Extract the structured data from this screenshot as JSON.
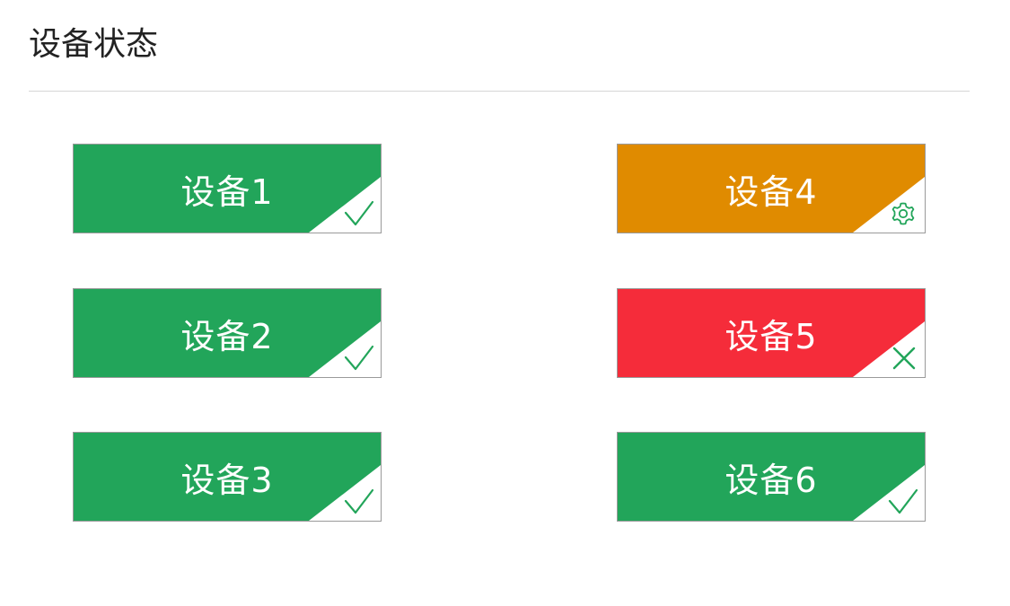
{
  "page": {
    "title": "设备状态"
  },
  "colors": {
    "normal": "#22a55a",
    "maintenance": "#e08b00",
    "error": "#f52c3a",
    "icon_green": "#22a55a"
  },
  "devices": [
    {
      "label": "设备1",
      "status": "normal",
      "icon": "check-icon"
    },
    {
      "label": "设备2",
      "status": "normal",
      "icon": "check-icon"
    },
    {
      "label": "设备3",
      "status": "normal",
      "icon": "check-icon"
    },
    {
      "label": "设备4",
      "status": "maintenance",
      "icon": "gear-icon"
    },
    {
      "label": "设备5",
      "status": "error",
      "icon": "close-icon"
    },
    {
      "label": "设备6",
      "status": "normal",
      "icon": "check-icon"
    }
  ]
}
